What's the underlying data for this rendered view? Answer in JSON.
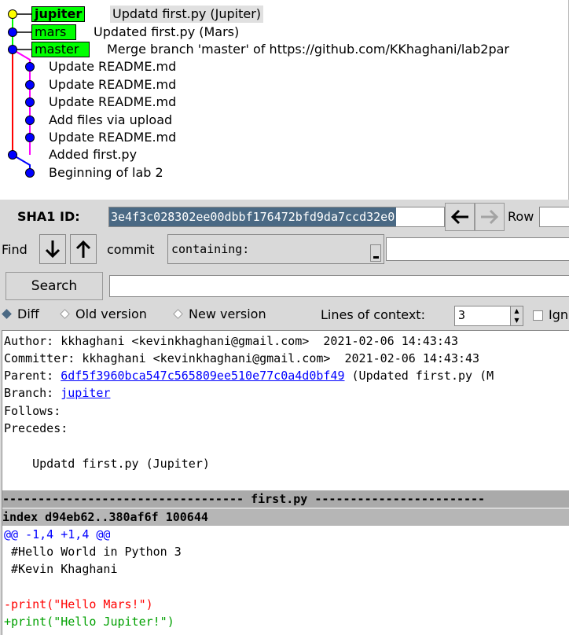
{
  "history": {
    "commits": [
      {
        "ref": "jupiter",
        "message": "Updatd first.py (Jupiter)"
      },
      {
        "ref": "mars",
        "message": "Updated first.py (Mars)"
      },
      {
        "ref": "master",
        "message": "Merge branch 'master' of https://github.com/KKhaghani/lab2par"
      },
      {
        "ref": "",
        "message": "Update README.md"
      },
      {
        "ref": "",
        "message": "Update README.md"
      },
      {
        "ref": "",
        "message": "Update README.md"
      },
      {
        "ref": "",
        "message": "Add files via upload"
      },
      {
        "ref": "",
        "message": "Update README.md"
      },
      {
        "ref": "",
        "message": "Added first.py"
      },
      {
        "ref": "",
        "message": "Beginning of lab 2"
      }
    ],
    "colors": {
      "ref_tag": "#00ff00",
      "head_node": "#ffff00",
      "node": "#0000ff",
      "line_main": "#ff0000",
      "line_branch": "#00ff00",
      "line_merge": "#ff00ff",
      "line_lower": "#0000ff"
    }
  },
  "sha": {
    "label": "SHA1 ID:",
    "value": "3e4f3c028302ee00dbbf176472bfd9da7ccd32e0",
    "back_icon": "arrow-left-icon",
    "forward_icon": "arrow-right-icon",
    "row_label": "Row"
  },
  "find": {
    "label": "Find",
    "down_icon": "arrow-down-icon",
    "up_icon": "arrow-up-icon",
    "type_label": "commit",
    "mode_value": "containing:",
    "input_value": ""
  },
  "search": {
    "button_label": "Search",
    "input_value": ""
  },
  "options": {
    "diff_label": "Diff",
    "old_label": "Old version",
    "new_label": "New version",
    "selected": "Diff",
    "context_label": "Lines of context:",
    "context_value": "3",
    "ignore_label": "Ign"
  },
  "details": {
    "author_line": "Author: kkhaghani <kevinkhaghani@gmail.com>  2021-02-06 14:43:43",
    "committer_line": "Committer: kkhaghani <kevinkhaghani@gmail.com>  2021-02-06 14:43:43",
    "parent_label": "Parent: ",
    "parent_sha": "6df5f3960bca547c565809ee510e77c0a4d0bf49",
    "parent_desc": " (Updated first.py (M",
    "branch_label": "Branch: ",
    "branch_name": "jupiter",
    "follows": "Follows:",
    "precedes": "Precedes:",
    "message": "    Updatd first.py (Jupiter)",
    "file_header": "---------------------------------- first.py ------------------------",
    "index_line": "index d94eb62..380af6f 100644",
    "hunk_header": "@@ -1,4 +1,4 @@",
    "context_lines": [
      " #Hello World in Python 3",
      " #Kevin Khaghani",
      ""
    ],
    "removed_line": "-print(\"Hello Mars!\")",
    "added_line": "+print(\"Hello Jupiter!\")"
  }
}
